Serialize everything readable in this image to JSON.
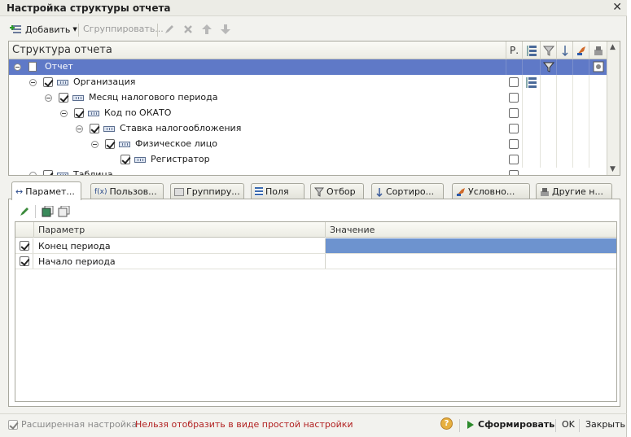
{
  "window": {
    "title": "Настройка структуры отчета",
    "close_glyph": "✕"
  },
  "toolbar": {
    "add_label": "Добавить",
    "group_label": "Сгруппировать...",
    "icons": [
      "add-icon",
      "pencil-icon",
      "delete-icon",
      "move-up-icon",
      "move-down-icon"
    ]
  },
  "tree": {
    "header": {
      "title": "Структура отчета",
      "col_r": "Р."
    },
    "rows": [
      {
        "label": "Отчет",
        "selected": true
      },
      {
        "label": "Организация"
      },
      {
        "label": "Месяц налогового периода"
      },
      {
        "label": "Код по ОКАТО"
      },
      {
        "label": "Ставка налогообложения"
      },
      {
        "label": "Физическое лицо"
      },
      {
        "label": "Регистратор"
      },
      {
        "label": "Таблица"
      }
    ]
  },
  "tabs": [
    {
      "label": "Парамет...",
      "icon": "parameters-icon",
      "active": true
    },
    {
      "label": "Пользов...",
      "icon": "function-icon"
    },
    {
      "label": "Группиру...",
      "icon": "grouping-icon"
    },
    {
      "label": "Поля",
      "icon": "fields-icon"
    },
    {
      "label": "Отбор",
      "icon": "filter-icon"
    },
    {
      "label": "Сортиро...",
      "icon": "sort-icon"
    },
    {
      "label": "Условно...",
      "icon": "conditional-icon"
    },
    {
      "label": "Другие н...",
      "icon": "other-settings-icon"
    }
  ],
  "params": {
    "columns": {
      "param": "Параметр",
      "value": "Значение"
    },
    "rows": [
      {
        "name": "Конец периода",
        "checked": true,
        "value": ""
      },
      {
        "name": "Начало периода",
        "checked": true,
        "value": ""
      }
    ]
  },
  "footer": {
    "extended_label": "Расширенная настройка",
    "warning": "Нельзя отобразить в виде простой настройки",
    "run_label": "Сформировать",
    "ok_label": "OK",
    "close_label": "Закрыть",
    "help_glyph": "?"
  },
  "colors": {
    "selection": "#5f79c7",
    "value_selection": "#6d93cf",
    "warning": "#b22222"
  }
}
